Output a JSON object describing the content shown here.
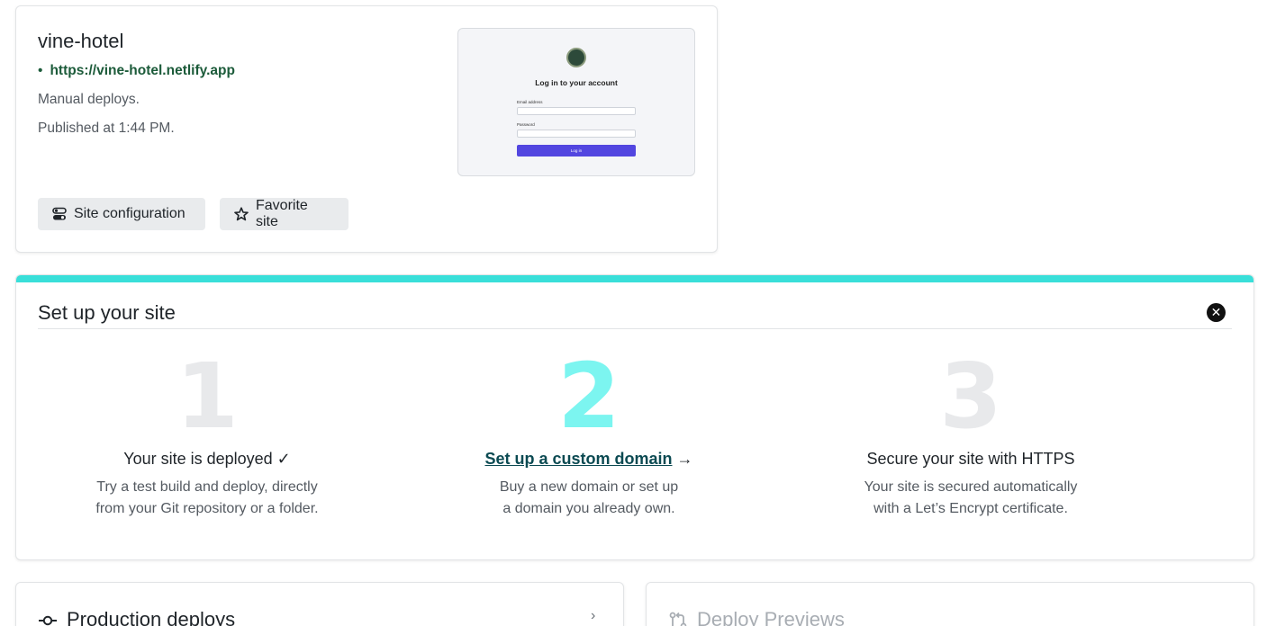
{
  "site": {
    "name": "vine-hotel",
    "url": "https://vine-hotel.netlify.app",
    "deploy_mode": "Manual deploys.",
    "published": "Published at 1:44 PM.",
    "buttons": {
      "config": "Site configuration",
      "favorite": "Favorite site"
    },
    "preview": {
      "title": "Log in to your account",
      "email_label": "Email address",
      "password_label": "Password",
      "button": "Log in"
    }
  },
  "setup": {
    "title": "Set up your site",
    "steps": [
      {
        "number": "1",
        "title": "Your site is deployed ✓",
        "desc_line1": "Try a test build and deploy, directly",
        "desc_line2": "from your Git repository or a folder."
      },
      {
        "number": "2",
        "title": "Set up a custom domain",
        "arrow": "→",
        "desc_line1": "Buy a new domain or set up",
        "desc_line2": "a domain you already own."
      },
      {
        "number": "3",
        "title": "Secure your site with HTTPS",
        "desc_line1": "Your site is secured automatically",
        "desc_line2": "with a Let’s Encrypt certificate."
      }
    ]
  },
  "sections": {
    "production": "Production deploys",
    "previews": "Deploy Previews"
  },
  "icons": {
    "config": "toggle-icon",
    "favorite": "star-icon",
    "close": "close-icon",
    "production": "commit-icon",
    "previews": "pull-request-icon",
    "chevron": "chevron-right-icon"
  },
  "colors": {
    "accent_bar": "#39dfd9",
    "active_step": "#7cf5f0",
    "link_green": "#1c5b3a",
    "preview_button": "#5246e0"
  }
}
